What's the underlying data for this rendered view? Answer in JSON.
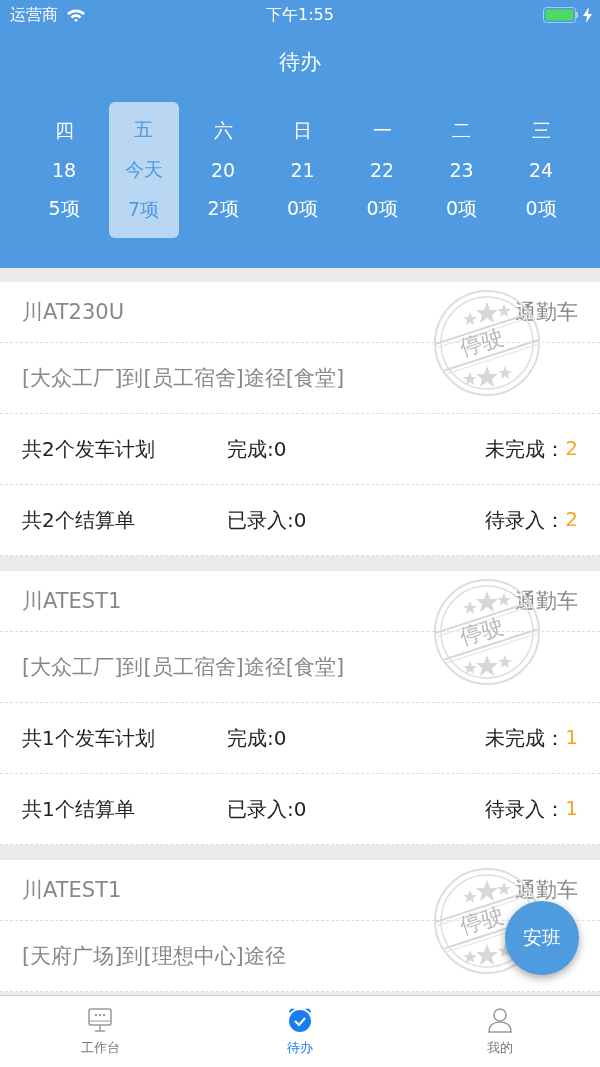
{
  "status_bar": {
    "carrier": "运营商",
    "time": "下午1:55"
  },
  "title": "待办",
  "days": [
    {
      "weekday": "四",
      "date": "18",
      "count": "5项",
      "selected": false
    },
    {
      "weekday": "五",
      "date": "今天",
      "count": "7项",
      "selected": true
    },
    {
      "weekday": "六",
      "date": "20",
      "count": "2项",
      "selected": false
    },
    {
      "weekday": "日",
      "date": "21",
      "count": "0项",
      "selected": false
    },
    {
      "weekday": "一",
      "date": "22",
      "count": "0项",
      "selected": false
    },
    {
      "weekday": "二",
      "date": "23",
      "count": "0项",
      "selected": false
    },
    {
      "weekday": "三",
      "date": "24",
      "count": "0项",
      "selected": false
    }
  ],
  "cards": [
    {
      "plate": "川AT230U",
      "type": "通勤车",
      "stamp": "停驶",
      "route": "[大众工厂]到[员工宿舍]途径[食堂]",
      "plans": {
        "total": "共2个发车计划",
        "done": "完成:0",
        "pending_label": "未完成：",
        "pending": "2"
      },
      "bills": {
        "total": "共2个结算单",
        "done": "已录入:0",
        "pending_label": "待录入：",
        "pending": "2"
      }
    },
    {
      "plate": "川ATEST1",
      "type": "通勤车",
      "stamp": "停驶",
      "route": "[大众工厂]到[员工宿舍]途径[食堂]",
      "plans": {
        "total": "共1个发车计划",
        "done": "完成:0",
        "pending_label": "未完成：",
        "pending": "1"
      },
      "bills": {
        "total": "共1个结算单",
        "done": "已录入:0",
        "pending_label": "待录入：",
        "pending": "1"
      }
    },
    {
      "plate": "川ATEST1",
      "type": "通勤车",
      "stamp": "停驶",
      "route": "[天府广场]到[理想中心]途径"
    }
  ],
  "fab": "安班",
  "tabs": [
    {
      "label": "工作台",
      "kind": "workbench",
      "selected": false
    },
    {
      "label": "待办",
      "kind": "todo",
      "selected": true
    },
    {
      "label": "我的",
      "kind": "profile",
      "selected": false
    }
  ]
}
